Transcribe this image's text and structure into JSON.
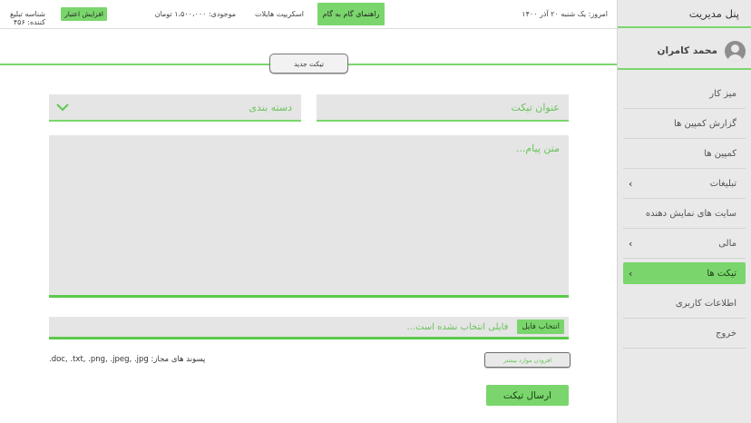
{
  "sidebar": {
    "title": "پنل مدیریت",
    "user_name": "محمد کامران",
    "items": [
      {
        "label": "میز کار",
        "chevron": false,
        "active": false
      },
      {
        "label": "گزارش کمپین ها",
        "chevron": false,
        "active": false
      },
      {
        "label": "کمپین ها",
        "chevron": false,
        "active": false
      },
      {
        "label": "تبلیغات",
        "chevron": true,
        "active": false
      },
      {
        "label": "سایت های نمایش دهنده",
        "chevron": false,
        "active": false
      },
      {
        "label": "مالی",
        "chevron": true,
        "active": false
      },
      {
        "label": "تیکت ها",
        "chevron": true,
        "active": true
      },
      {
        "label": "اطلاعات کاربری",
        "chevron": false,
        "active": false
      },
      {
        "label": "خروج",
        "chevron": false,
        "active": false
      }
    ]
  },
  "topbar": {
    "date": "امروز: یک شنبه ۲۰ آذر ۱۴۰۰",
    "guide_label": "راهنمای گام به گام",
    "script_label": "اسکریپت هایلات",
    "balance": "موجودی: ۱،۵۰۰،۰۰۰ تومان",
    "credit_button": "افزایش اعتبار",
    "advertiser_id": "شناسه تبلیغ کننده: ۴۵۶"
  },
  "tab": {
    "new_ticket": "تیکت جدید"
  },
  "form": {
    "title_placeholder": "عنوان تیکت",
    "category_placeholder": "دسته بندی",
    "message_placeholder": "متن پیام...",
    "file_button": "انتخاب فایل",
    "file_status": "فایلی انتخاب نشده است...",
    "add_more": "افزودن موارد بیشتر",
    "allowed_label": "پسوند های مجاز:",
    "allowed_ext": ".doc, .txt, .png, .jpeg, .jpg",
    "send_button": "ارسال تیکت"
  },
  "colors": {
    "accent": "#7ad66c",
    "sidebar_bg": "#e9e9e9",
    "field_bg": "#e5e5e5"
  },
  "icons": {
    "avatar": "user-avatar-icon",
    "chevron": "chevron-left-icon",
    "dropdown": "chevron-down-icon"
  }
}
